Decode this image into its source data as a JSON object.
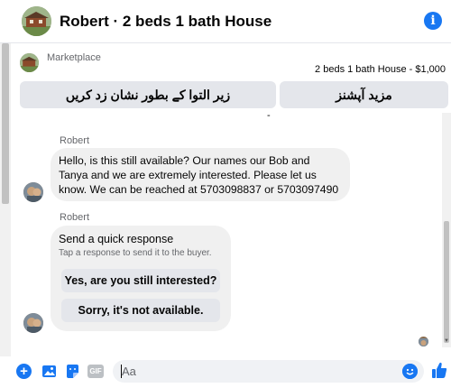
{
  "header": {
    "title": "Robert · 2 beds 1 bath House",
    "info_icon": "info-icon"
  },
  "marketplace": {
    "label": "Marketplace",
    "listing": "2 beds 1 bath House - $1,000",
    "buttons": {
      "report": "زیر التوا کے بطور نشان زد کریں",
      "more": "مزید آپشنز"
    }
  },
  "clipped_fragment": "-",
  "messages": [
    {
      "sender": "Robert",
      "text": "Hello, is this still available? Our names our Bob and Tanya and we are extremely interested. Please let us know. We can be reached at 5703098837 or 5703097490"
    },
    {
      "sender": "Robert",
      "quick_response": {
        "title": "Send a quick response",
        "subtitle": "Tap a response to send it to the buyer.",
        "options": [
          "Yes, are you still interested?",
          "Sorry, it's not available."
        ]
      }
    }
  ],
  "composer": {
    "placeholder": "Aa",
    "icons": [
      "plus-icon",
      "image-icon",
      "sticker-icon",
      "gif-icon",
      "emoji-icon",
      "like-icon"
    ],
    "gif_label": "GIF"
  },
  "colors": {
    "accent": "#1877f2",
    "bubble": "#f0f0f0",
    "button": "#e4e6eb",
    "secondary_text": "#65676b"
  }
}
